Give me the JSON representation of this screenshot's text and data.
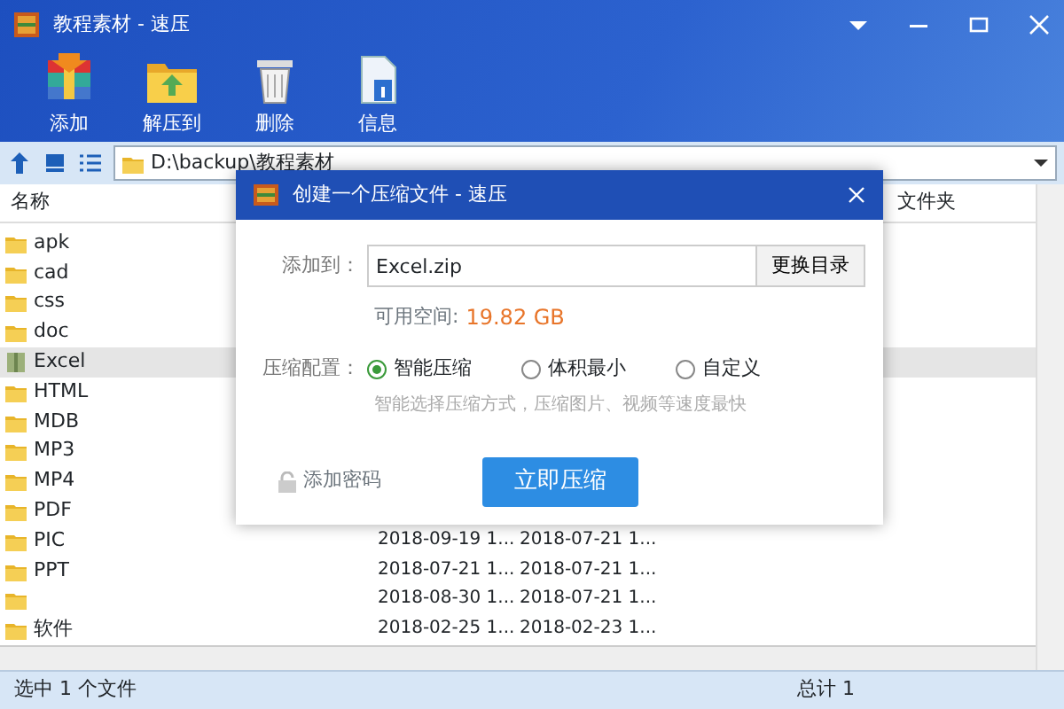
{
  "window": {
    "title": "教程素材 - 速压"
  },
  "toolbar": [
    {
      "label": "添加",
      "kind": "add"
    },
    {
      "label": "解压到",
      "kind": "extract"
    },
    {
      "label": "删除",
      "kind": "delete"
    },
    {
      "label": "信息",
      "kind": "info"
    }
  ],
  "address": {
    "path": "D:\\backup\\教程素材"
  },
  "table": {
    "columns": [
      "名称",
      "文件夹"
    ],
    "rows": [
      {
        "name": "apk",
        "selected": false,
        "kind": "folder"
      },
      {
        "name": "cad",
        "selected": false,
        "kind": "folder"
      },
      {
        "name": "css",
        "selected": false,
        "kind": "folder"
      },
      {
        "name": "doc",
        "selected": false,
        "kind": "folder"
      },
      {
        "name": "Excel",
        "selected": true,
        "kind": "archive"
      },
      {
        "name": "HTML",
        "selected": false,
        "kind": "folder"
      },
      {
        "name": "MDB",
        "selected": false,
        "kind": "folder"
      },
      {
        "name": "MP3",
        "selected": false,
        "kind": "folder"
      },
      {
        "name": "MP4",
        "selected": false,
        "kind": "folder"
      },
      {
        "name": "PDF",
        "selected": false,
        "kind": "folder"
      },
      {
        "name": "PIC",
        "selected": false,
        "kind": "folder",
        "created": "2018-09-19 1...",
        "modified": "2018-07-21 1..."
      },
      {
        "name": "PPT",
        "selected": false,
        "kind": "folder",
        "created": "2018-07-21 1...",
        "modified": "2018-07-21 1..."
      },
      {
        "selected": false,
        "kind": "folder",
        "created": "2018-08-30 1...",
        "modified": "2018-07-21 1..."
      },
      {
        "name": "软件",
        "selected": false,
        "kind": "folder",
        "created": "2018-02-25 1...",
        "modified": "2018-02-23 1..."
      }
    ]
  },
  "dialog": {
    "title": "创建一个压缩文件 - 速压",
    "add_to_label": "添加到：",
    "filename": "Excel.zip",
    "change_dir_button": "更换目录",
    "space_label": "可用空间:",
    "space_value": "19.82 GB",
    "config_label": "压缩配置：",
    "options": [
      {
        "label": "智能压缩",
        "selected": true
      },
      {
        "label": "体积最小",
        "selected": false
      },
      {
        "label": "自定义",
        "selected": false
      }
    ],
    "hint": "智能选择压缩方式，压缩图片、视频等速度最快",
    "password_label": "添加密码",
    "compress_button": "立即压缩"
  },
  "status_bar": {
    "left": "选中 1 个文件",
    "right": "总计 1"
  }
}
